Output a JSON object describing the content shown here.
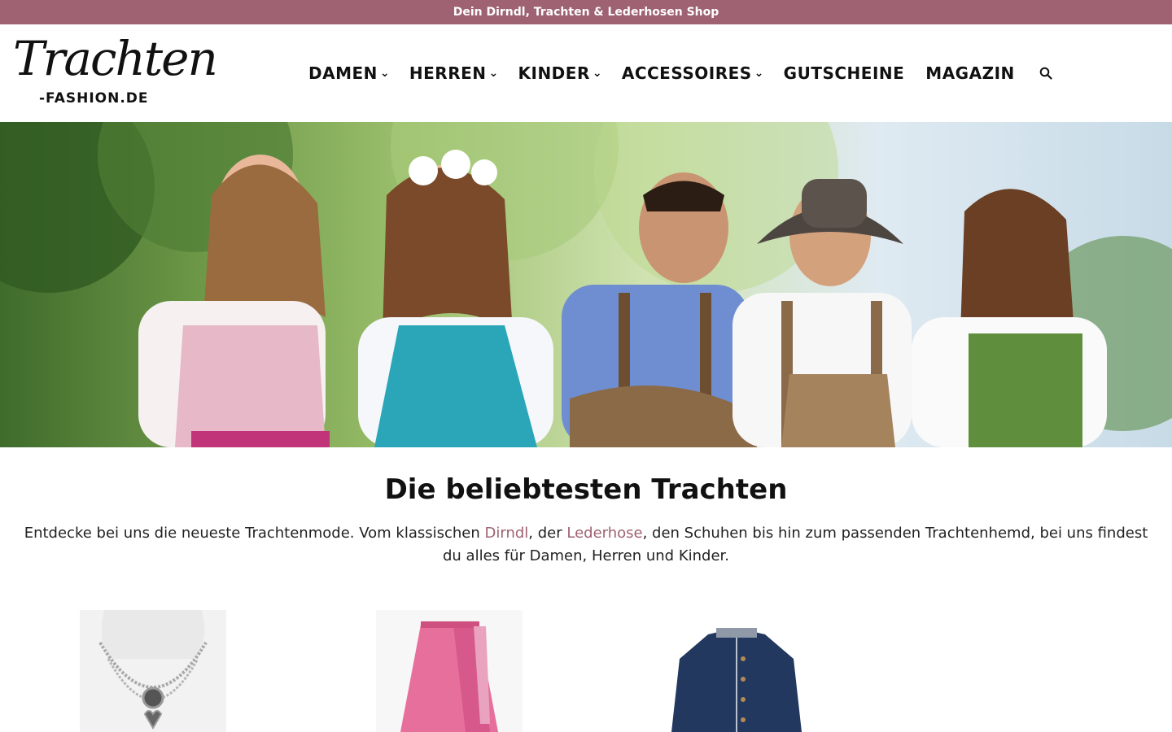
{
  "topbar": {
    "text": "Dein Dirndl, Trachten & Lederhosen Shop"
  },
  "logo": {
    "script_text": "Trachten",
    "sub_text": "-FASHION.DE"
  },
  "nav": {
    "items": [
      {
        "label": "DAMEN",
        "has_dropdown": true
      },
      {
        "label": "HERREN",
        "has_dropdown": true
      },
      {
        "label": "KINDER",
        "has_dropdown": true
      },
      {
        "label": "ACCESSOIRES",
        "has_dropdown": true
      },
      {
        "label": "GUTSCHEINE",
        "has_dropdown": false
      },
      {
        "label": "MAGAZIN",
        "has_dropdown": false
      }
    ],
    "search_icon": "search-icon"
  },
  "hero": {
    "image": "group-in-traditional-bavarian-clothing"
  },
  "section": {
    "title": "Die beliebtesten Trachten",
    "intro_part1": "Entdecke bei uns die neueste Trachtenmode. Vom klassischen ",
    "link_dirndl": "Dirndl",
    "intro_part2": ", der ",
    "link_lederhose": "Lederhose",
    "intro_part3": ", den Schuhen bis hin zum passenden Trachtenhemd, bei uns findest du alles für Damen, Herren und Kinder."
  },
  "products": [
    {
      "image": "necklace"
    },
    {
      "image": "pink-apron-skirt"
    },
    {
      "image": "navy-trachten-jacket"
    }
  ],
  "colors": {
    "accent": "#9e6272",
    "text": "#111111"
  }
}
